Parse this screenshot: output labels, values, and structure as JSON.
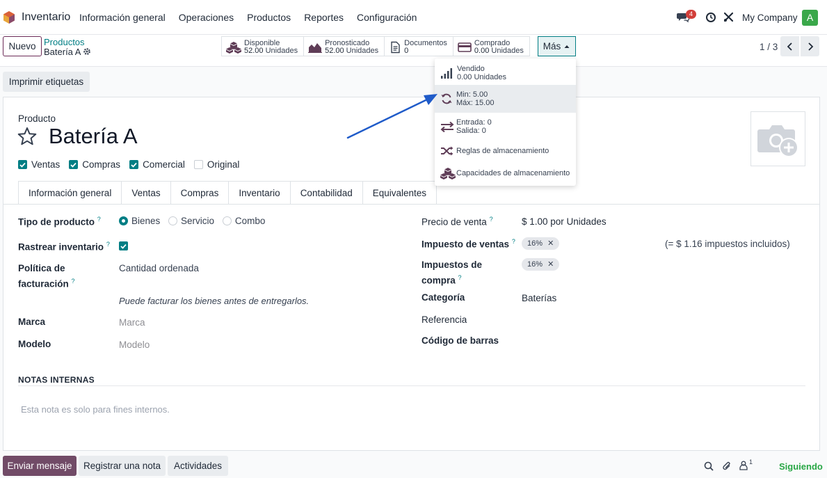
{
  "navbar": {
    "app_name": "Inventario",
    "menu": [
      "Información general",
      "Operaciones",
      "Productos",
      "Reportes",
      "Configuración"
    ],
    "chat_badge": "4",
    "company": "My Company",
    "avatar_letter": "A"
  },
  "control": {
    "new_label": "Nuevo",
    "breadcrumb_parent": "Productos",
    "breadcrumb_current": "Batería A",
    "stats": [
      {
        "label": "Disponible",
        "value": "52.00",
        "unit": "Unidades"
      },
      {
        "label": "Pronosticado",
        "value": "52.00",
        "unit": "Unidades"
      },
      {
        "label": "Documentos",
        "value": "0",
        "unit": ""
      },
      {
        "label": "Comprado",
        "value": "0.00",
        "unit": "Unidades"
      }
    ],
    "more_label": "Más",
    "pager": "1 / 3"
  },
  "more_menu": {
    "sold_label": "Vendido",
    "sold_value": "0.00",
    "sold_unit": "Unidades",
    "min_label": "Min:",
    "min_value": "5.00",
    "max_label": "Máx:",
    "max_value": "15.00",
    "in_label": "Entrada:",
    "in_value": "0",
    "out_label": "Salida:",
    "out_value": "0",
    "rules": "Reglas de almacenamiento",
    "capacities": "Capacidades de almacenamiento"
  },
  "print_label": "Imprimir etiquetas",
  "form": {
    "product_label": "Producto",
    "name": "Batería A",
    "checks": [
      {
        "label": "Ventas",
        "checked": true
      },
      {
        "label": "Compras",
        "checked": true
      },
      {
        "label": "Comercial",
        "checked": true
      },
      {
        "label": "Original",
        "checked": false
      }
    ],
    "tabs": [
      "Información general",
      "Ventas",
      "Compras",
      "Inventario",
      "Contabilidad",
      "Equivalentes"
    ],
    "product_type_label": "Tipo de producto",
    "product_type_options": [
      "Bienes",
      "Servicio",
      "Combo"
    ],
    "track_label": "Rastrear inventario",
    "invoice_policy_label_1": "Política de",
    "invoice_policy_label_2": "facturación",
    "invoice_policy_value": "Cantidad ordenada",
    "invoice_hint": "Puede facturar los bienes antes de entregarlos.",
    "brand_label": "Marca",
    "brand_placeholder": "Marca",
    "model_label": "Modelo",
    "model_placeholder": "Modelo",
    "sale_price_label": "Precio de venta",
    "sale_price_value": "$ 1.00 por Unidades",
    "sales_tax_label": "Impuesto de ventas",
    "sales_tax_tag": "16%",
    "tax_included": "(= $ 1.16 impuestos incluidos)",
    "purchase_tax_label_1": "Impuestos de",
    "purchase_tax_label_2": "compra",
    "purchase_tax_tag": "16%",
    "category_label": "Categoría",
    "category_value": "Baterías",
    "reference_label": "Referencia",
    "barcode_label": "Código de barras",
    "notes_header": "NOTAS INTERNAS",
    "notes_placeholder": "Esta nota es solo para fines internos.",
    "help_mark": "?"
  },
  "chatter": {
    "send": "Enviar mensaje",
    "note": "Registrar una nota",
    "activities": "Actividades",
    "followers_count": "1",
    "following": "Siguiendo"
  },
  "colors": {
    "accent": "#017e84",
    "brand": "#714b67",
    "arrow": "#1f5bc9"
  }
}
